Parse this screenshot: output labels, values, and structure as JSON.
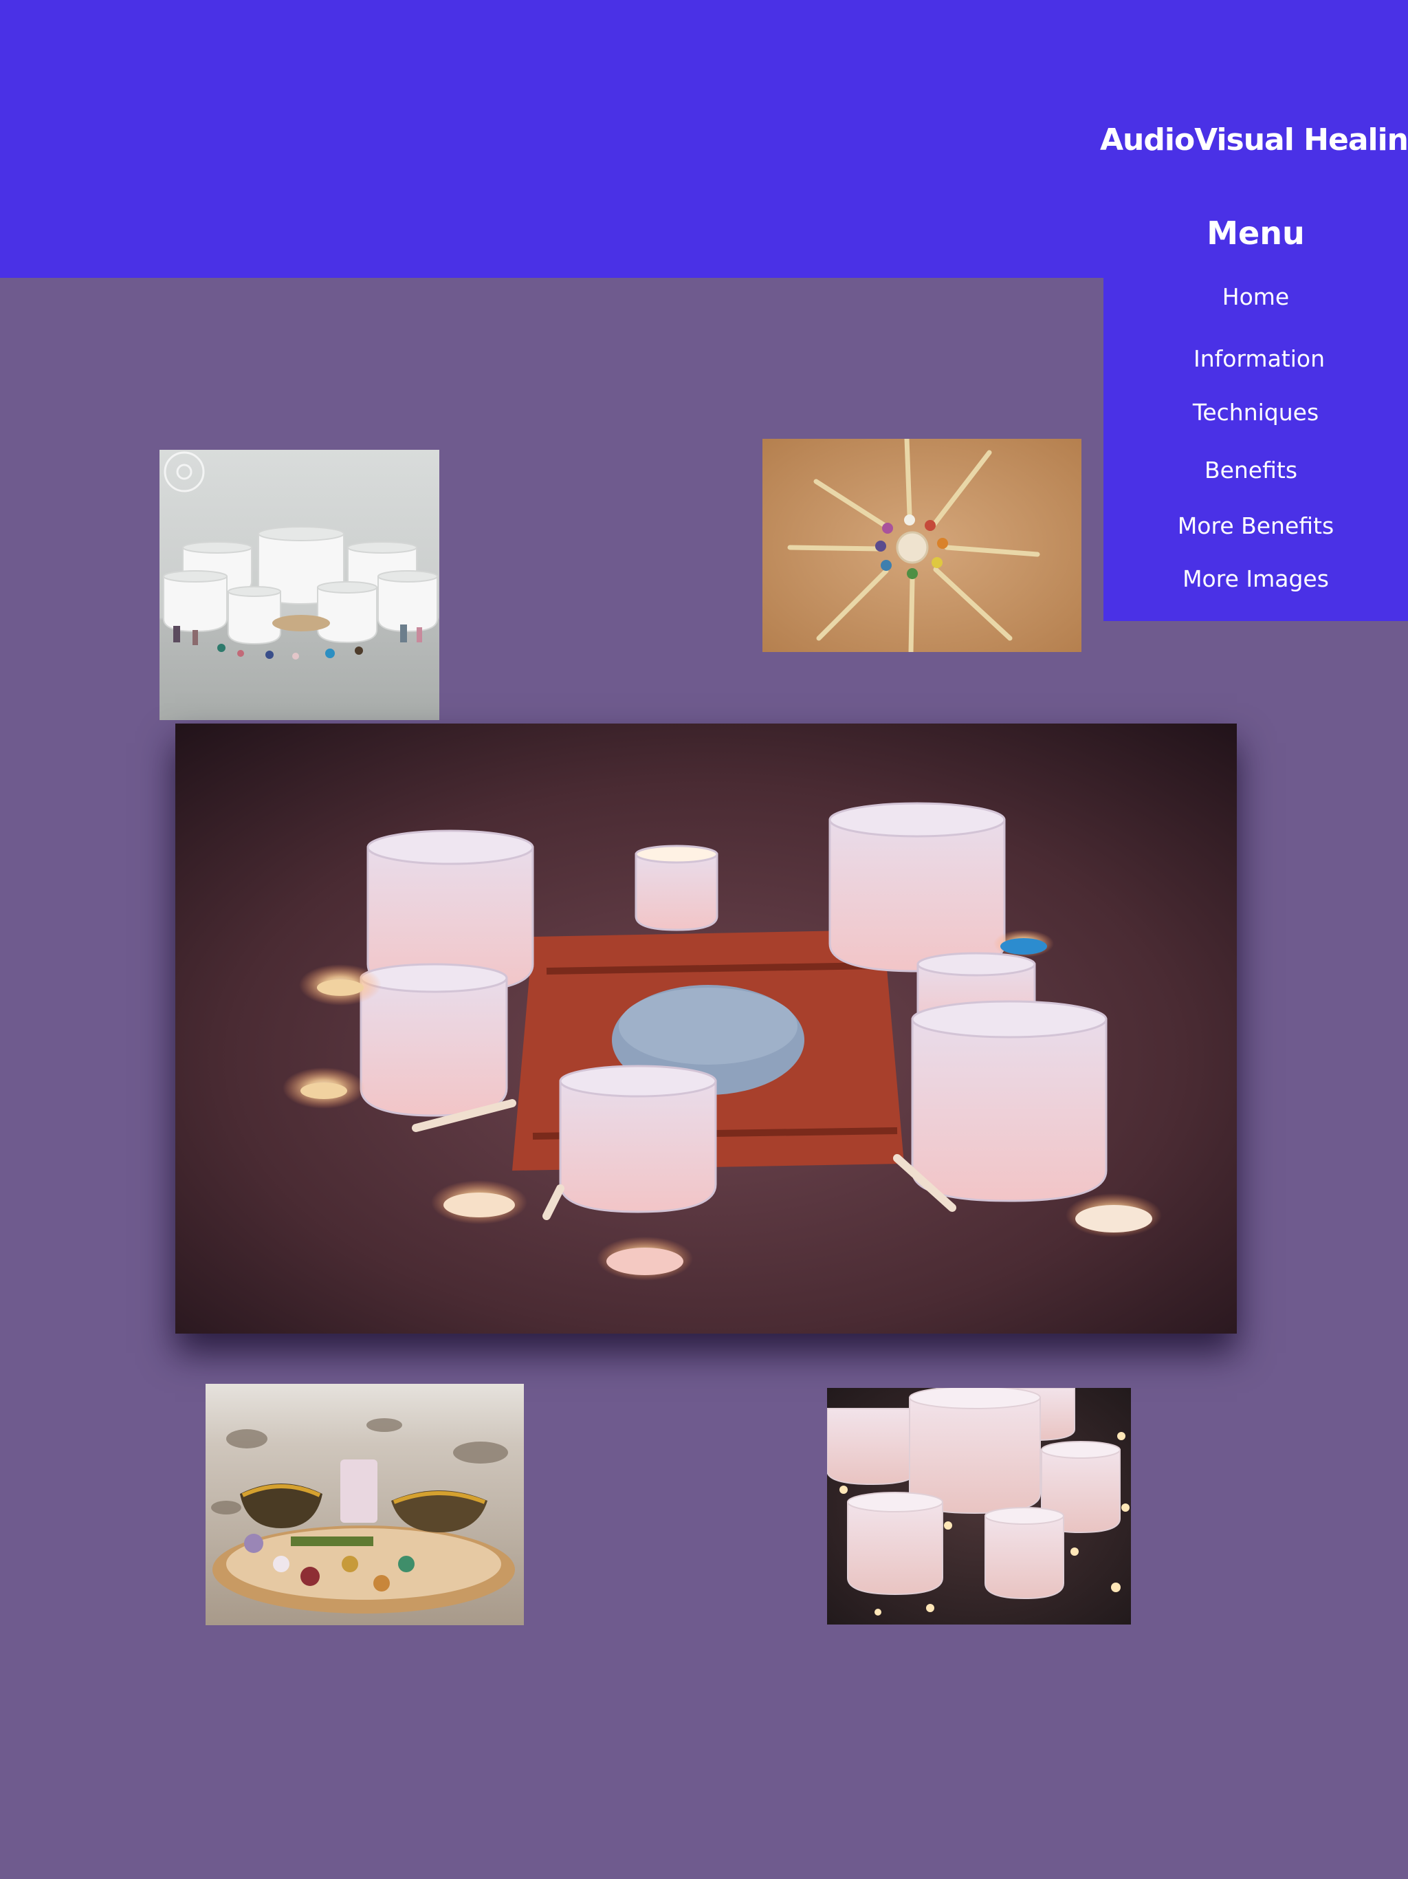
{
  "site": {
    "title": "AudioVisual Healing"
  },
  "menu": {
    "heading": "Menu",
    "items": [
      {
        "label": "Home"
      },
      {
        "label": "Information"
      },
      {
        "label": "Techniques"
      },
      {
        "label": "Benefits"
      },
      {
        "label": "More Benefits"
      },
      {
        "label": "More Images"
      }
    ]
  },
  "colors": {
    "header_background": "#4a31e6",
    "page_background": "#6f5b8e",
    "menu_text": "#ffffff"
  },
  "images": [
    {
      "name": "white crystal singing bowls with gemstones"
    },
    {
      "name": "tuning forks arranged in a circle"
    },
    {
      "name": "crystal singing bowls lit with candles on a rug"
    },
    {
      "name": "singing bowls and crystals on a wooden slab at the beach"
    },
    {
      "name": "glowing crystal singing bowls with lotus candles"
    }
  ]
}
